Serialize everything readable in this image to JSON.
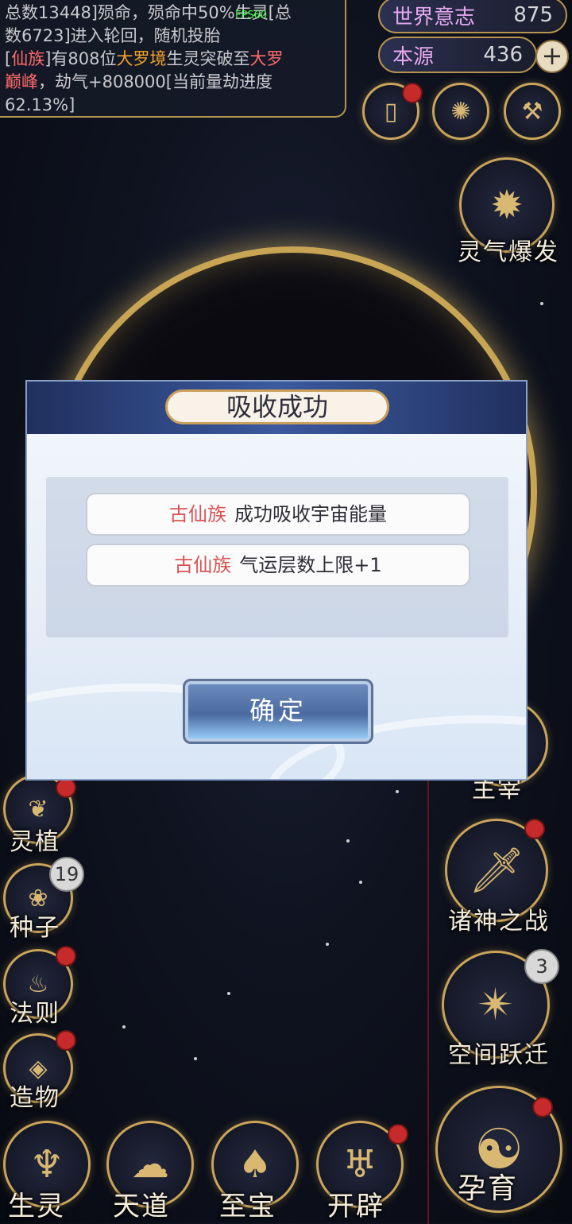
{
  "fps": "FPS60",
  "log": {
    "line1": "总数13448]殒命，殒命中50%生灵[总",
    "line2": "数6723]进入轮回，随机投胎",
    "line3_a": "[",
    "line3_race": "仙族",
    "line3_b": "]有808位",
    "line3_realm": "大罗境",
    "line3_c": "生灵突破至",
    "line3_realm2": "大罗",
    "line4_realm": "巅峰",
    "line4_b": "，劫气+808000[当前量劫进度",
    "line5": "62.13%]"
  },
  "resources": {
    "world_will": {
      "label": "世界意志",
      "value": "875"
    },
    "origin": {
      "label": "本源",
      "value": "436"
    },
    "plus": "+"
  },
  "right_menu": {
    "aura_burst": "灵气爆发",
    "lord": "主宰",
    "gods_war": "诸神之战",
    "space_jump": "空间跃迁",
    "space_jump_badge": "3",
    "breed": "孕育"
  },
  "left_menu": {
    "spirit_plant": "灵植",
    "seed": "种子",
    "seed_badge": "19",
    "law": "法则",
    "creation": "造物"
  },
  "bottom_nav": {
    "creature": "生灵",
    "heaven": "天道",
    "treasure": "至宝",
    "open": "开辟"
  },
  "dialog": {
    "title": "吸收成功",
    "msg1_race": "古仙族",
    "msg1_text": "成功吸收宇宙能量",
    "msg2_race": "古仙族",
    "msg2_text": "气运层数上限+1",
    "confirm": "确定"
  },
  "colors": {
    "gold": "#c9a45a",
    "race_red": "#d85454",
    "realm_orange": "#f0a12a",
    "badge_red": "#c62a2a"
  }
}
